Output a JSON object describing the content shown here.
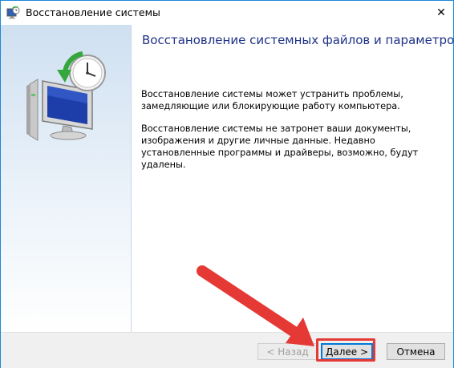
{
  "window": {
    "title": "Восстановление системы",
    "close_glyph": "✕"
  },
  "content": {
    "heading": "Восстановление системных файлов и параметров",
    "paragraph1": "Восстановление системы может устранить проблемы, замедляющие или блокирующие работу компьютера.",
    "paragraph2": "Восстановление системы не затронет ваши документы, изображения и другие личные данные. Недавно установленные программы и драйверы, возможно, будут удалены."
  },
  "buttons": {
    "back_label": "< Назад",
    "next_label": "Далее >",
    "cancel_label": "Отмена",
    "back_enabled": false
  },
  "icons": {
    "title_icon": "system-restore-icon",
    "hero_icon": "system-restore-computer-clock-icon",
    "close_icon": "close-icon"
  },
  "colors": {
    "heading": "#1e3287",
    "annotation": "#e53935",
    "default_button_border": "#0078d7"
  }
}
